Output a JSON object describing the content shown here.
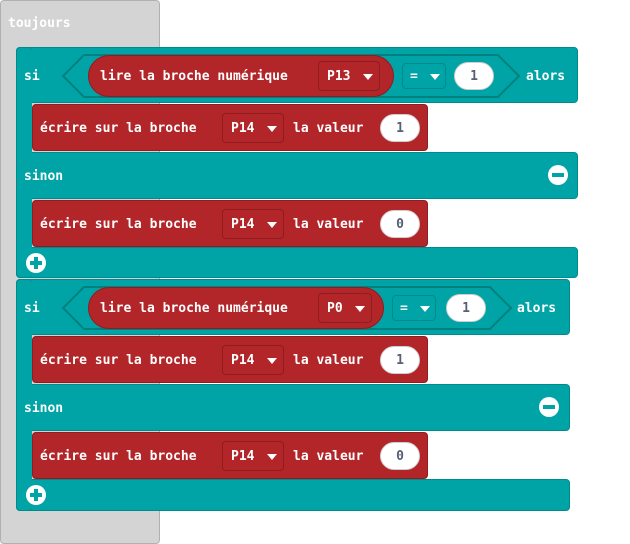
{
  "forever": {
    "label": "toujours"
  },
  "if_blocks": [
    {
      "if_label": "si",
      "then_label": "alors",
      "condition": {
        "read_label": "lire la broche numérique",
        "pin": "P13",
        "operator": "=",
        "value": "1"
      },
      "then_stmt": {
        "label": "écrire sur la broche",
        "pin": "P14",
        "value_label": "la valeur",
        "value": "1"
      },
      "else_label": "sinon",
      "else_stmt": {
        "label": "écrire sur la broche",
        "pin": "P14",
        "value_label": "la valeur",
        "value": "0"
      }
    },
    {
      "if_label": "si",
      "then_label": "alors",
      "condition": {
        "read_label": "lire la broche numérique",
        "pin": "P0",
        "operator": "=",
        "value": "1"
      },
      "then_stmt": {
        "label": "écrire sur la broche",
        "pin": "P14",
        "value_label": "la valeur",
        "value": "1"
      },
      "else_label": "sinon",
      "else_stmt": {
        "label": "écrire sur la broche",
        "pin": "P14",
        "value_label": "la valeur",
        "value": "0"
      }
    }
  ]
}
